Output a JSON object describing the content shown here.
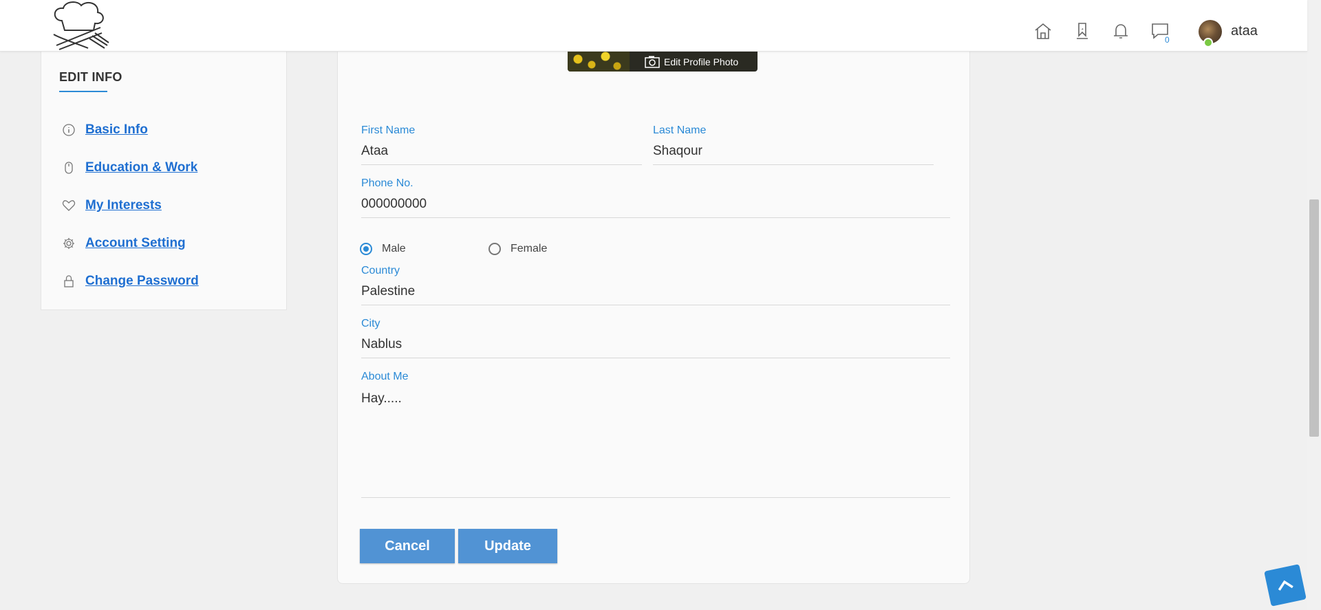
{
  "header": {
    "nav_icons": [
      "home-icon",
      "bookmark-icon",
      "bell-icon",
      "chat-icon"
    ],
    "messages_count": "0",
    "username": "ataa"
  },
  "sidebar": {
    "title": "EDIT INFO",
    "items": [
      {
        "label": "Basic Info",
        "icon": "info-icon"
      },
      {
        "label": "Education & Work",
        "icon": "mouse-icon"
      },
      {
        "label": "My Interests",
        "icon": "heart-icon"
      },
      {
        "label": "Account Setting",
        "icon": "gear-icon"
      },
      {
        "label": "Change Password",
        "icon": "lock-icon"
      }
    ]
  },
  "profile": {
    "edit_photo_label": "Edit Profile Photo"
  },
  "form": {
    "first_name": {
      "label": "First Name",
      "value": "Ataa"
    },
    "last_name": {
      "label": "Last Name",
      "value": "Shaqour"
    },
    "phone": {
      "label": "Phone No.",
      "value": "000000000"
    },
    "gender": {
      "options": [
        {
          "label": "Male",
          "checked": true
        },
        {
          "label": "Female",
          "checked": false
        }
      ]
    },
    "country": {
      "label": "Country",
      "value": "Palestine"
    },
    "city": {
      "label": "City",
      "value": "Nablus"
    },
    "about": {
      "label": "About Me",
      "value": "Hay....."
    },
    "cancel_label": "Cancel",
    "update_label": "Update"
  },
  "colors": {
    "accent": "#2b8ad6",
    "button": "#5193d4",
    "link": "#1f6fd1"
  }
}
